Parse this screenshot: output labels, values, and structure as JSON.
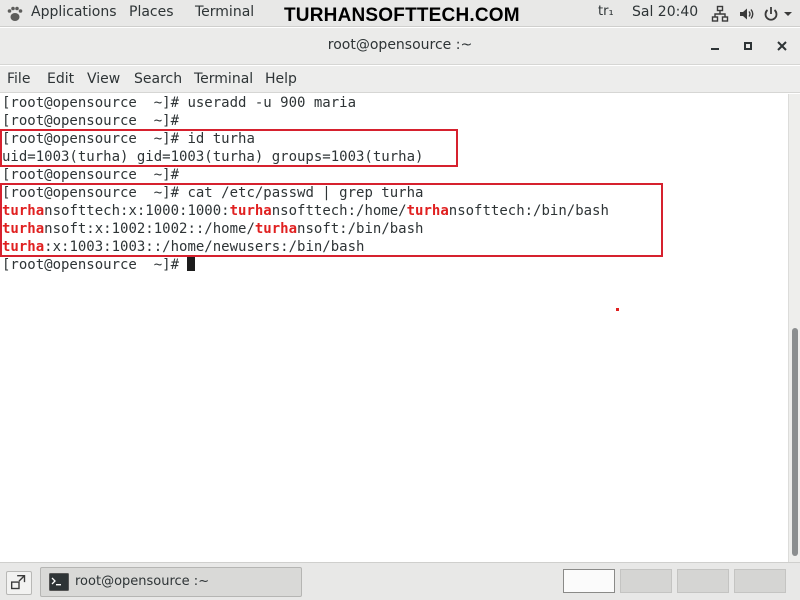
{
  "top_panel": {
    "applications": "Applications",
    "places": "Places",
    "terminal": "Terminal",
    "watermark": "TURHANSOFTTECH.COM",
    "keyboard_layout": "tr₁",
    "clock": "Sal 20:40",
    "icons": [
      "gnome-foot-icon",
      "network-icon",
      "volume-icon",
      "power-icon",
      "dropdown-arrow-icon"
    ]
  },
  "window": {
    "title": "root@opensource :~",
    "buttons": [
      "minimize-icon",
      "maximize-icon",
      "close-icon"
    ]
  },
  "menubar": {
    "file": "File",
    "edit": "Edit",
    "view": "View",
    "search": "Search",
    "terminal": "Terminal",
    "help": "Help"
  },
  "terminal": {
    "prompt": "[root@opensource  ~]# ",
    "lines": {
      "l1_cmd": "useradd -u 900 maria",
      "l3_cmd": "id turha",
      "l4": "uid=1003(turha) gid=1003(turha) groups=1003(turha)",
      "l6_cmd": "cat /etc/passwd | grep turha",
      "l7": {
        "m1": "turha",
        "t1": "nsofttech:x:1000:1000:",
        "m2": "turha",
        "t2": "nsofttech:/home/",
        "m3": "turha",
        "t3": "nsofttech:/bin/bash"
      },
      "l8": {
        "m1": "turha",
        "t1": "nsoft:x:1002:1002::/home/",
        "m2": "turha",
        "t2": "nsoft:/bin/bash"
      },
      "l9": {
        "m1": "turha",
        "t1": ":x:1003:1003::/home/newusers:/bin/bash"
      }
    },
    "match_color": "#e02020",
    "annotation_color": "#d6212e"
  },
  "taskbar": {
    "task_label": "root@opensource :~",
    "workspaces": 4,
    "active_workspace": 1
  }
}
